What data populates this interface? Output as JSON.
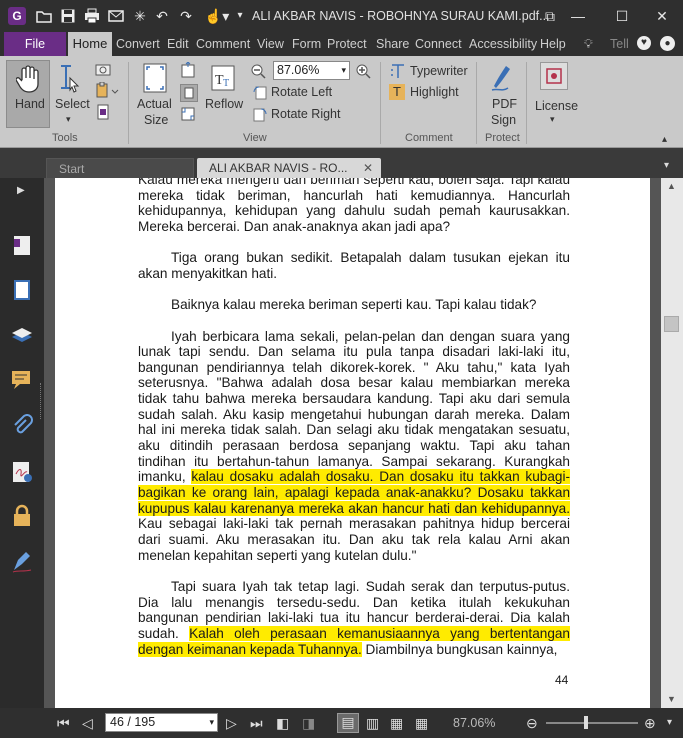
{
  "window": {
    "title": "ALI AKBAR NAVIS - ROBOHNYA SURAU KAMI.pdf...",
    "accent": "#6a2d86"
  },
  "menu": {
    "file": "File",
    "items": [
      "Home",
      "Convert",
      "Edit",
      "Comment",
      "View",
      "Form",
      "Protect",
      "Share",
      "Connect",
      "Accessibility",
      "Help"
    ],
    "tell": "Tell"
  },
  "ribbon": {
    "hand": "Hand",
    "select": "Select",
    "actual_size_1": "Actual",
    "actual_size_2": "Size",
    "reflow": "Reflow",
    "zoom_value": "87.06%",
    "rotate_left": "Rotate Left",
    "rotate_right": "Rotate Right",
    "typewriter": "Typewriter",
    "highlight": "Highlight",
    "pdf_sign_1": "PDF",
    "pdf_sign_2": "Sign",
    "license": "License",
    "groups": {
      "tools": "Tools",
      "view": "View",
      "comment": "Comment",
      "protect": "Protect"
    }
  },
  "tabs": {
    "start": "Start",
    "doc": "ALI AKBAR NAVIS - RO..."
  },
  "document": {
    "paragraphs": [
      {
        "indent": false,
        "parts": [
          {
            "t": "Kalau mereka mengerti dan beriman seperti kau, boleh saja. Tapi kalau mereka tidak beriman, hancurlah hati kemudiannya. Hancurlah kehidupannya, kehidupan yang dahulu sudah pemah kaurusakkan. Mereka bercerai. Dan anak-anaknya akan jadi apa?",
            "h": false
          }
        ]
      },
      {
        "indent": true,
        "parts": [
          {
            "t": "Tiga orang bukan sedikit. Betapalah dalam tusukan ejekan itu akan menyakitkan hati.",
            "h": false
          }
        ]
      },
      {
        "indent": true,
        "parts": [
          {
            "t": "Baiknya kalau mereka beriman seperti kau. Tapi kalau tidak?",
            "h": false
          }
        ]
      },
      {
        "indent": true,
        "parts": [
          {
            "t": "Iyah berbicara lama sekali, pelan-pelan dan dengan suara yang lunak tapi sendu. Dan selama itu pula tanpa disadari laki-laki itu, bangunan pendiriannya telah dikorek-korek. \" Aku tahu,\" kata Iyah seterusnya. \"Bahwa adalah dosa besar kalau membiarkan mereka tidak tahu bahwa mereka bersaudara kandung. Tapi aku dari semula sudah salah. Aku kasip mengetahui hubungan darah mereka. Dalam hal ini mereka tidak salah. Dan selagi aku tidak mengatakan sesuatu, aku ditindih perasaan berdosa sepanjang waktu. Tapi aku tahan tindihan itu bertahun-tahun lamanya. Sampai sekarang. Kurangkah imanku, ",
            "h": false
          },
          {
            "t": "kalau dosaku adalah dosaku. Dan dosaku itu takkan kubagi-bagikan ke orang lain, apalagi kepada anak-anakku? Dosaku takkan kupupus kalau karenanya mereka akan hancur hati dan kehidupannya.",
            "h": true
          },
          {
            "t": " Kau sebagai laki-laki tak pernah merasakan pahitnya hidup bercerai dari suami. Aku merasakan itu. Dan aku tak rela kalau Arni akan menelan kepahitan seperti yang kutelan dulu.\"",
            "h": false
          }
        ]
      },
      {
        "indent": true,
        "parts": [
          {
            "t": "Tapi suara Iyah tak tetap lagi. Sudah serak dan terputus-putus. Dia lalu menangis tersedu-sedu. Dan ketika itulah kekukuhan bangunan pendirian laki-laki tua itu hancur berderai-derai. Dia kalah sudah. ",
            "h": false
          },
          {
            "t": "Kalah oleh perasaan kemanusiaannya yang bertentangan dengan keimanan kepada Tuhannya.",
            "h": true
          },
          {
            "t": " Diambilnya bungkusan kainnya,",
            "h": false
          }
        ]
      }
    ],
    "page_number": "44",
    "highlight_color": "#ffeb00"
  },
  "status": {
    "page_field": "46 / 195",
    "zoom": "87.06%"
  }
}
